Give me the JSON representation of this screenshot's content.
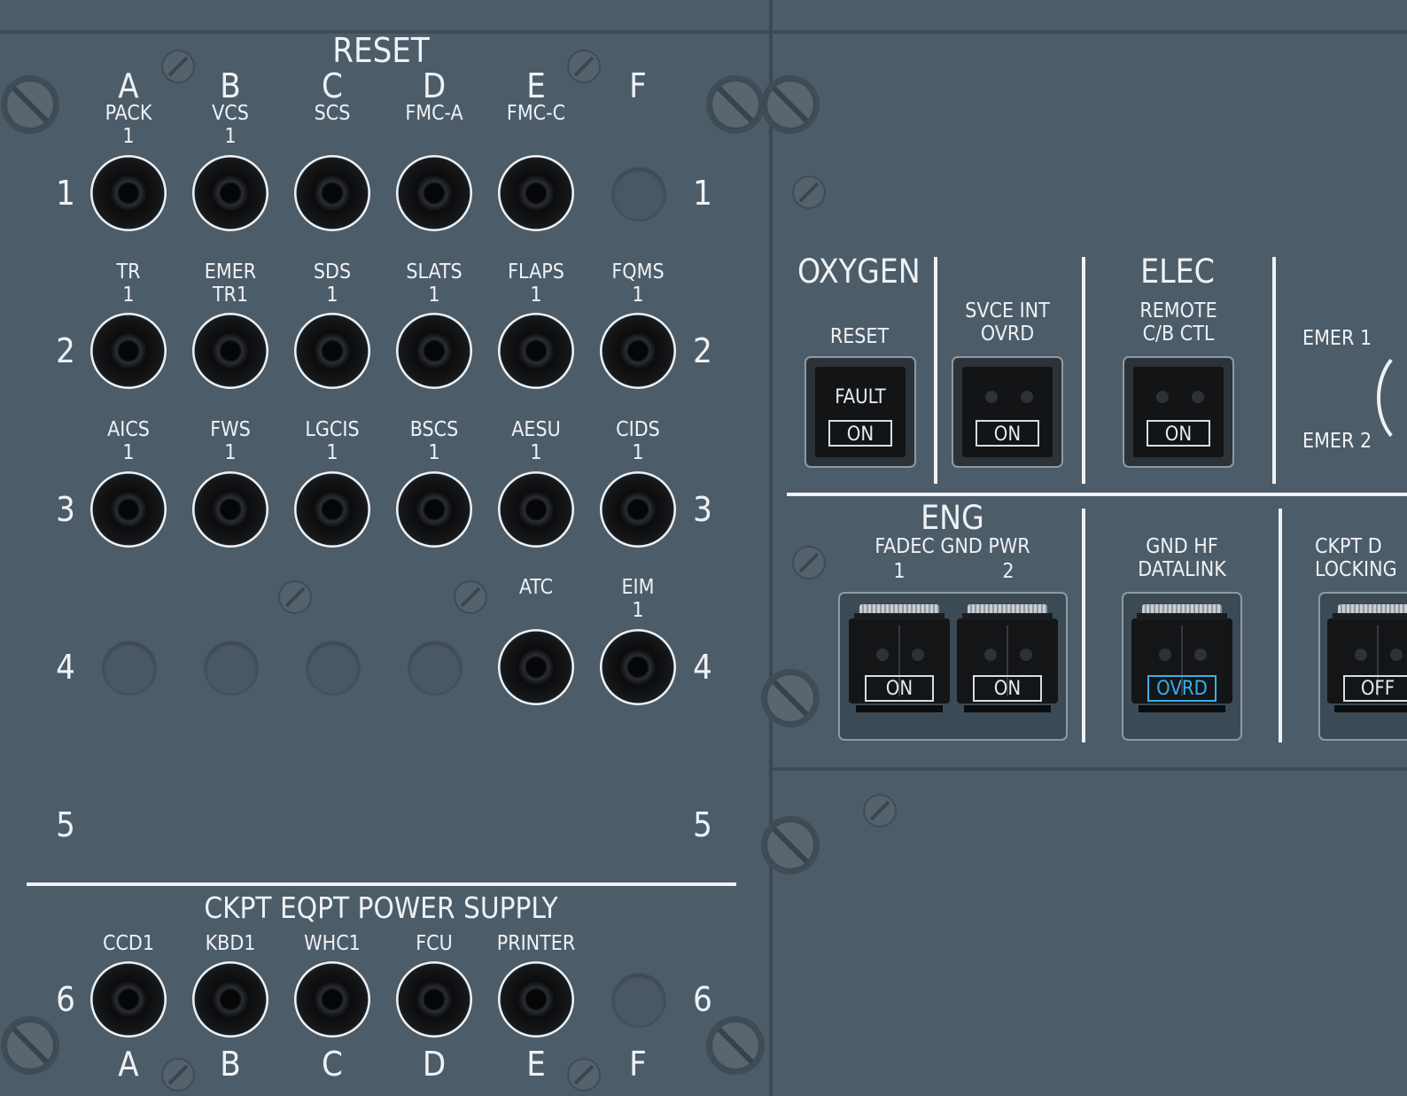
{
  "left_panel": {
    "reset_title": "RESET",
    "columns": [
      "A",
      "B",
      "C",
      "D",
      "E",
      "F"
    ],
    "rows": [
      "1",
      "2",
      "3",
      "4",
      "5"
    ],
    "row_labels": [
      [
        "PACK\n1",
        "VCS\n1",
        "SCS",
        "FMC-A",
        "FMC-C",
        ""
      ],
      [
        "TR\n1",
        "EMER\nTR1",
        "SDS\n1",
        "SLATS\n1",
        "FLAPS\n1",
        "FQMS\n1"
      ],
      [
        "AICS\n1",
        "FWS\n1",
        "LGCIS\n1",
        "BSCS\n1",
        "AESU\n1",
        "CIDS\n1"
      ],
      [
        "",
        "",
        "",
        "",
        "ATC",
        "EIM\n1"
      ]
    ],
    "breakers": [
      [
        true,
        true,
        true,
        true,
        true,
        false
      ],
      [
        true,
        true,
        true,
        true,
        true,
        true
      ],
      [
        true,
        true,
        true,
        true,
        true,
        true
      ],
      [
        false,
        false,
        false,
        false,
        true,
        true
      ]
    ],
    "ckpt_title": "CKPT EQPT POWER SUPPLY",
    "ckpt_row_num": "6",
    "ckpt_labels": [
      "CCD1",
      "KBD1",
      "WHC1",
      "FCU",
      "PRINTER",
      ""
    ],
    "ckpt_breakers": [
      true,
      true,
      true,
      true,
      true,
      false
    ],
    "bottom_columns": [
      "A",
      "B",
      "C",
      "D",
      "E",
      "F"
    ]
  },
  "right_panel": {
    "oxygen": {
      "title": "OXYGEN",
      "reset_label": "RESET",
      "fault_label": "FAULT",
      "on_label": "ON"
    },
    "svce_int": {
      "label": "SVCE INT\nOVRD",
      "on_label": "ON"
    },
    "elec": {
      "title": "ELEC",
      "label": "REMOTE\nC/B CTL",
      "on_label": "ON"
    },
    "emer": {
      "emer1": "EMER 1",
      "emer2": "EMER 2"
    },
    "eng": {
      "title": "ENG",
      "label": "FADEC GND PWR",
      "num1": "1",
      "num2": "2",
      "on1": "ON",
      "on2": "ON"
    },
    "gnd_hf": {
      "label": "GND HF\nDATALINK",
      "ovrd_label": "OVRD",
      "ovrd_color": "#3ab0e8"
    },
    "ckpt_door": {
      "label": "CKPT D\nLOCKING",
      "off_label": "OFF"
    }
  },
  "colors": {
    "panel": "#4d5c69",
    "legend_white": "#eef2f5",
    "ovrd_blue": "#3ab0e8"
  }
}
